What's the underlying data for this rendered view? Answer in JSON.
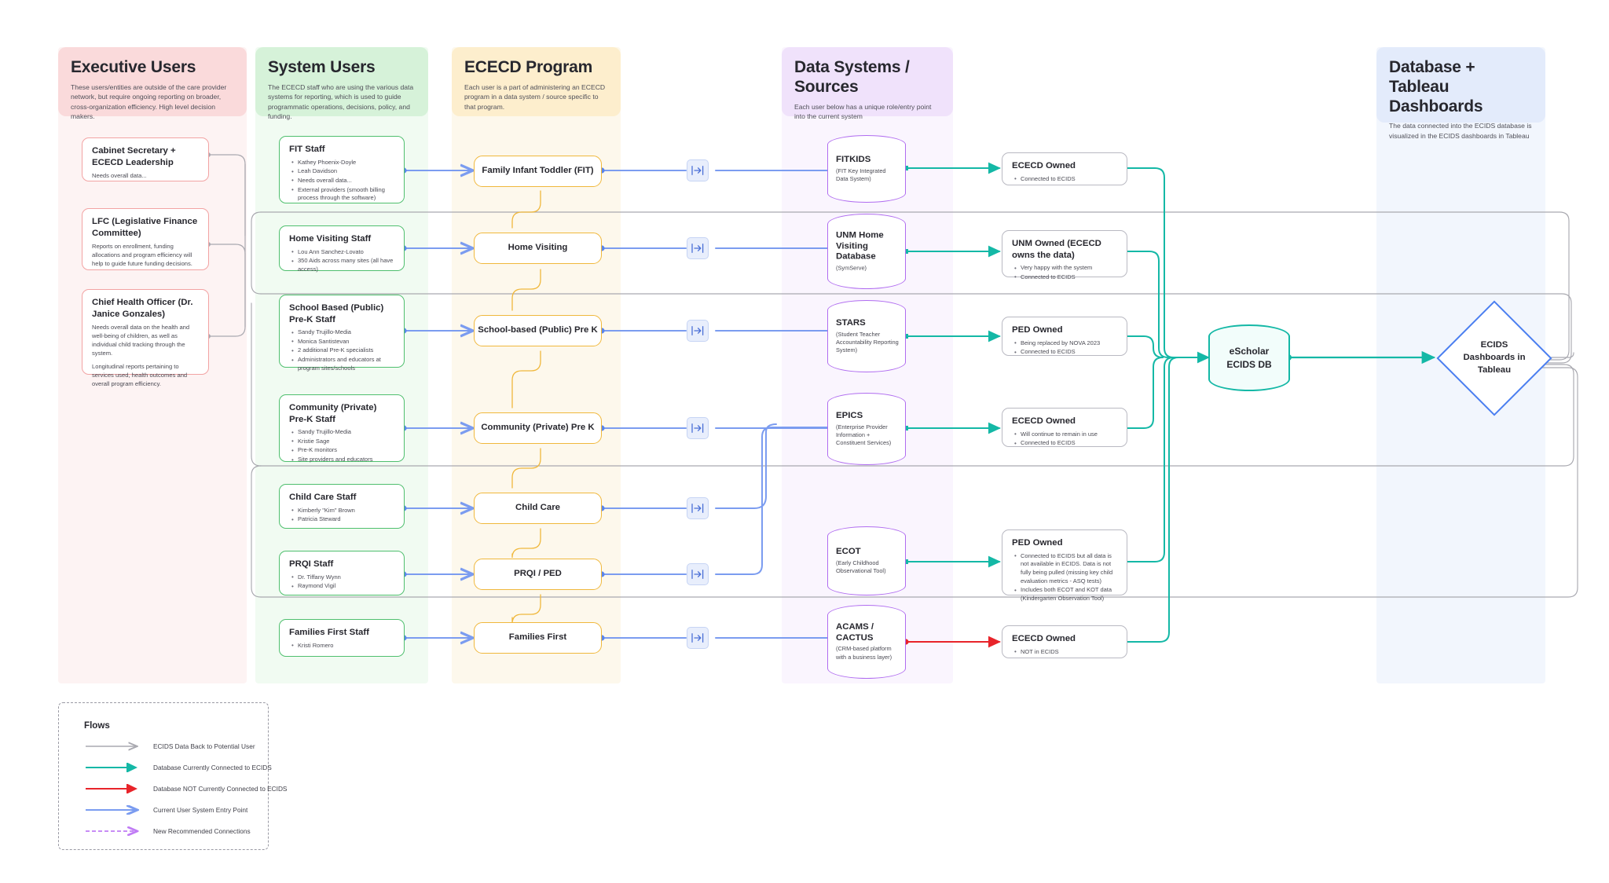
{
  "columns": [
    {
      "key": "executive",
      "title": "Executive Users",
      "desc": "These users/entities are outside of the care provider network, but require ongoing reporting on broader, cross-organization efficiency. High level decision makers.",
      "header_bg": "#fadadb",
      "band_bg": "#fdf3f3"
    },
    {
      "key": "system",
      "title": "System Users",
      "desc": "The ECECD staff who are using the various data systems for reporting, which is used to guide programmatic operations, decisions, policy, and funding.",
      "header_bg": "#d6f2d9",
      "band_bg": "#f1fbf2"
    },
    {
      "key": "program",
      "title": "ECECD Program",
      "desc": "Each user is a part of administering an ECECD program in a data system / source specific to that program.",
      "header_bg": "#fdeecd",
      "band_bg": "#fdf8ec"
    },
    {
      "key": "datasystems",
      "title": "Data Systems / Sources",
      "desc": "Each user below has a unique role/entry point into the current system",
      "header_bg": "#f0e2fb",
      "band_bg": "#faf5fe"
    },
    {
      "key": "dashboards",
      "title": "Database + Tableau Dashboards",
      "desc": "The data connected into the ECIDS database is visualized in the ECIDS dashboards in Tableau",
      "header_bg": "#e3ebfb",
      "band_bg": "#f2f6fd"
    }
  ],
  "executive_users": [
    {
      "title": "Cabinet Secretary + ECECD Leadership",
      "notes": [
        "Needs overall data..."
      ],
      "bullets": []
    },
    {
      "title": "LFC (Legislative Finance Committee)",
      "notes": [
        "Reports on enrollment, funding allocations and program efficiency will help to guide future funding decisions."
      ],
      "bullets": []
    },
    {
      "title": "Chief Health Officer (Dr. Janice Gonzales)",
      "notes": [
        "Needs overall data on the health and well-being of children, as well as individual child tracking through the system.",
        "Longitudinal reports pertaining to services used, health outcomes and overall program efficiency."
      ],
      "bullets": []
    }
  ],
  "system_users": [
    {
      "title": "FIT Staff",
      "bullets": [
        "Kathey Phoenix-Doyle",
        "Leah Davidson",
        "Needs overall data...",
        "External providers (smooth billing process through the software)"
      ]
    },
    {
      "title": "Home Visiting Staff",
      "bullets": [
        "Lou Ann Sanchez-Lovato",
        "350 Aids across many sites (all have access)"
      ]
    },
    {
      "title": "School Based (Public) Pre-K Staff",
      "bullets": [
        "Sandy Trujillo-Media",
        "Monica Santistevan",
        "2 additional Pre-K specialists",
        "Administrators and educators at program sites/schools"
      ]
    },
    {
      "title": "Community (Private) Pre-K Staff",
      "bullets": [
        "Sandy Trujillo-Media",
        "Kristie Sage",
        "Pre-K monitors",
        "Site providers and educators"
      ]
    },
    {
      "title": "Child Care Staff",
      "bullets": [
        "Kimberly \"Kim\" Brown",
        "Patricia Steward"
      ]
    },
    {
      "title": "PRQI Staff",
      "bullets": [
        "Dr. Tiffany Wynn",
        "Raymond Vigil"
      ]
    },
    {
      "title": "Families First Staff",
      "bullets": [
        "Kristi Romero"
      ]
    }
  ],
  "programs": [
    {
      "label": "Family Infant Toddler (FIT)"
    },
    {
      "label": "Home Visiting"
    },
    {
      "label": "School-based (Public) Pre K"
    },
    {
      "label": "Community (Private) Pre K"
    },
    {
      "label": "Child Care"
    },
    {
      "label": "PRQI / PED"
    },
    {
      "label": "Families First"
    }
  ],
  "entry_icon": "login-entry-icon",
  "data_systems": [
    {
      "name": "FITKIDS",
      "sub": "(FIT Key Integrated Data System)"
    },
    {
      "name": "UNM Home Visiting Database",
      "sub": "(SymServe)"
    },
    {
      "name": "STARS",
      "sub": "(Student Teacher Accountability Reporting System)"
    },
    {
      "name": "EPICS",
      "sub": "(Enterprise Provider Information + Constituent Services)"
    },
    {
      "name": "ECOT",
      "sub": "(Early Childhood Observational Tool)"
    },
    {
      "name": "ACAMS / CACTUS",
      "sub": "(CRM-based platform with a business layer)"
    }
  ],
  "ownership": [
    {
      "title": "ECECD Owned",
      "bullets": [
        "Connected to ECIDS"
      ]
    },
    {
      "title": "UNM Owned (ECECD owns the data)",
      "bullets": [
        "Very happy with the system",
        "Connected to ECIDS"
      ]
    },
    {
      "title": "PED Owned",
      "bullets": [
        "Being replaced by NOVA 2023",
        "Connected to ECIDS"
      ]
    },
    {
      "title": "ECECD Owned",
      "bullets": [
        "Will continue to remain in use",
        "Connected to ECIDS"
      ]
    },
    {
      "title": "PED Owned",
      "bullets": [
        "Connected to ECIDS but all data is not available in ECIDS. Data is not fully being pulled (missing key child evaluation metrics - ASQ tests)",
        "Includes both ECOT and KOT data (Kindergarten Observation Tool)"
      ]
    },
    {
      "title": "ECECD Owned",
      "bullets": [
        "NOT in ECIDS"
      ]
    }
  ],
  "database": {
    "line1": "eScholar",
    "line2": "ECIDS DB"
  },
  "dashboard": {
    "line1": "ECIDS",
    "line2": "Dashboards in",
    "line3": "Tableau"
  },
  "legend": {
    "title": "Flows",
    "items": [
      {
        "label": "ECIDS Data Back to Potential User",
        "color": "#a9a9b0",
        "dashed": false
      },
      {
        "label": "Database Currently Connected to ECIDS",
        "color": "#14b8a6",
        "dashed": false
      },
      {
        "label": "Database NOT Currently Connected to ECIDS",
        "color": "#e8242a",
        "dashed": false
      },
      {
        "label": "Current User System Entry Point",
        "color": "#7b9cf0",
        "dashed": false
      },
      {
        "label": "New Recommended Connections",
        "color": "#c07cf5",
        "dashed": true
      }
    ]
  },
  "colors": {
    "exec_border": "#f2a3a3",
    "sys_border": "#4fbf6e",
    "program_border": "#f0b83c",
    "db_border": "#b06cf0",
    "connected": "#14b8a6",
    "not_connected": "#e8242a",
    "entry": "#7b9cf0",
    "feedback": "#a9a9b0",
    "dashboard_border": "#4a7ef0"
  }
}
